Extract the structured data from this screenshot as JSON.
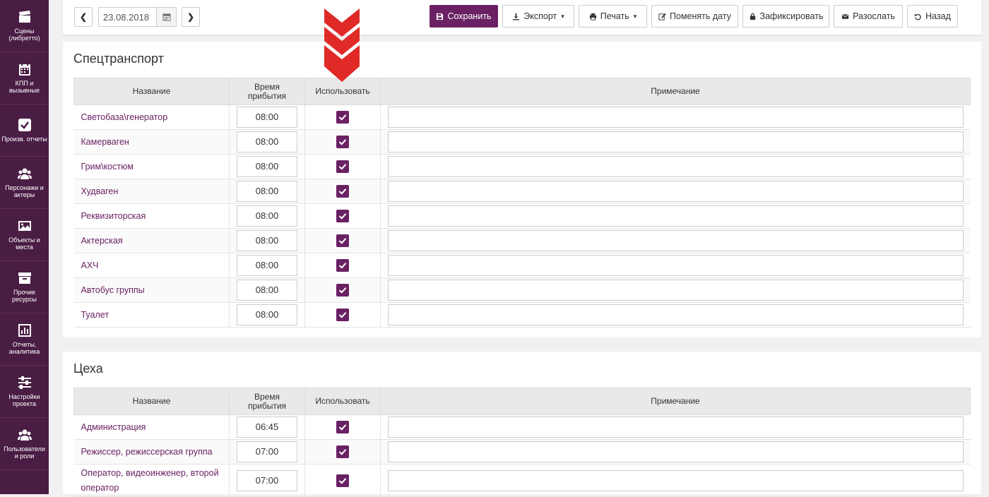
{
  "sidebar": {
    "items": [
      {
        "label": "Сцены (либретто)",
        "icon": "clapperboard-icon"
      },
      {
        "label": "КПП и вызывные",
        "icon": "calendar-icon"
      },
      {
        "label": "Произв. отчеты",
        "icon": "check-square-icon"
      },
      {
        "label": "Персонажи и актеры",
        "icon": "users-icon"
      },
      {
        "label": "Объекты и места",
        "icon": "image-icon"
      },
      {
        "label": "Прочие ресурсы",
        "icon": "archive-icon"
      },
      {
        "label": "Отчеты, аналитика",
        "icon": "bar-chart-icon"
      },
      {
        "label": "Настройки проекта",
        "icon": "sliders-icon"
      },
      {
        "label": "Пользователи и роли",
        "icon": "users-icon"
      }
    ]
  },
  "toolbar": {
    "prev": "❮",
    "next": "❯",
    "date": "23.08.2018",
    "save": "Сохранить",
    "export": "Экспорт",
    "print": "Печать",
    "change_date": "Поменять дату",
    "lock": "Зафиксировать",
    "send": "Разослать",
    "back": "Назад"
  },
  "colors": {
    "sidebar": "#4a1d45",
    "accent": "#6a2163",
    "marker": "#e02a27"
  },
  "columns": {
    "name": "Название",
    "arrival": "Время прибытия",
    "use": "Использовать",
    "note": "Примечание"
  },
  "transport": {
    "title": "Спецтранспорт",
    "rows": [
      {
        "name": "Светобаза\\генератор",
        "time": "08:00",
        "use": true,
        "note": ""
      },
      {
        "name": "Камерваген",
        "time": "08:00",
        "use": true,
        "note": ""
      },
      {
        "name": "Грим\\костюм",
        "time": "08:00",
        "use": true,
        "note": ""
      },
      {
        "name": "Худваген",
        "time": "08:00",
        "use": true,
        "note": ""
      },
      {
        "name": "Реквизиторская",
        "time": "08:00",
        "use": true,
        "note": ""
      },
      {
        "name": "Актерская",
        "time": "08:00",
        "use": true,
        "note": ""
      },
      {
        "name": "АХЧ",
        "time": "08:00",
        "use": true,
        "note": ""
      },
      {
        "name": "Автобус группы",
        "time": "08:00",
        "use": true,
        "note": ""
      },
      {
        "name": "Туалет",
        "time": "08:00",
        "use": true,
        "note": ""
      }
    ]
  },
  "workshops": {
    "title": "Цеха",
    "rows": [
      {
        "name": "Администрация",
        "time": "06:45",
        "use": true,
        "note": ""
      },
      {
        "name": "Режиссер, режиссерская группа",
        "time": "07:00",
        "use": true,
        "note": ""
      },
      {
        "name": "Оператор, видеоинженер, второй оператор",
        "time": "07:00",
        "use": true,
        "note": ""
      }
    ]
  }
}
